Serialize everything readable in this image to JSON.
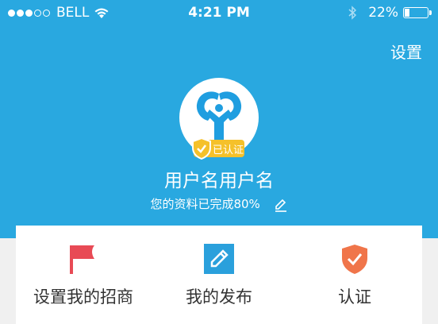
{
  "statusbar": {
    "carrier": "BELL",
    "time": "4:21 PM",
    "battery": "22%"
  },
  "header": {
    "settings_label": "设置",
    "badge_text": "已认证",
    "username": "用户名用户名",
    "profile_status": "您的资料已完成80%"
  },
  "menu": [
    {
      "label": "设置我的招商",
      "icon": "flag-icon",
      "color": "#e84a55"
    },
    {
      "label": "我的发布",
      "icon": "edit-icon",
      "color": "#2aa0dc"
    },
    {
      "label": "认证",
      "icon": "shield-check-icon",
      "color": "#f0754a"
    }
  ],
  "colors": {
    "header_bg": "#29a8e0",
    "badge": "#f5c12a"
  }
}
